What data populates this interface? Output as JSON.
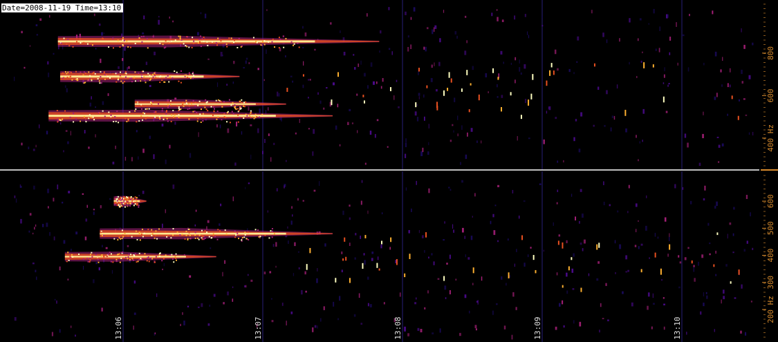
{
  "timestamp": {
    "date_label": "Date=2008-11-19",
    "time_label": "Time=13:10"
  },
  "colors": {
    "background": "#000000",
    "axis_text": "#d98c2e",
    "separator": "#ffffff",
    "colormap": [
      "#000000",
      "#1a0a5c",
      "#4a0a8a",
      "#a8207a",
      "#e85020",
      "#ffb030",
      "#ffffc0"
    ]
  },
  "chart_data": [
    {
      "type": "heatmap",
      "panel": "upper",
      "title": "",
      "xlabel": "",
      "ylabel": "",
      "y_unit_label": "Hz",
      "y_ticks": [
        {
          "value": 800,
          "label": "800"
        },
        {
          "value": 600,
          "label": "600"
        },
        {
          "value": 400,
          "label": "400 Hz"
        }
      ],
      "ylim": [
        250,
        1050
      ],
      "traces": [
        {
          "t_start": "13:05:32",
          "t_end": "13:07:50",
          "freq": 855,
          "intensity": 0.95
        },
        {
          "t_start": "13:05:33",
          "t_end": "13:06:50",
          "freq": 690,
          "intensity": 1.0
        },
        {
          "t_start": "13:05:28",
          "t_end": "13:07:30",
          "freq": 505,
          "intensity": 1.0
        },
        {
          "t_start": "13:06:05",
          "t_end": "13:07:10",
          "freq": 560,
          "intensity": 0.7
        }
      ]
    },
    {
      "type": "heatmap",
      "panel": "lower",
      "title": "",
      "xlabel": "",
      "ylabel": "",
      "y_unit_label": "Hz",
      "y_ticks": [
        {
          "value": 600,
          "label": "600"
        },
        {
          "value": 500,
          "label": "500"
        },
        {
          "value": 400,
          "label": "400"
        },
        {
          "value": 300,
          "label": "300"
        },
        {
          "value": 200,
          "label": "200 Hz"
        }
      ],
      "ylim": [
        80,
        710
      ],
      "x_ticks": [
        "13:06",
        "13:07",
        "13:08",
        "13:09",
        "13:10"
      ],
      "traces": [
        {
          "t_start": "13:05:56",
          "t_end": "13:06:10",
          "freq": 600,
          "intensity": 0.8
        },
        {
          "t_start": "13:05:50",
          "t_end": "13:07:30",
          "freq": 480,
          "intensity": 0.9
        },
        {
          "t_start": "13:05:35",
          "t_end": "13:06:40",
          "freq": 395,
          "intensity": 0.75
        }
      ]
    }
  ]
}
